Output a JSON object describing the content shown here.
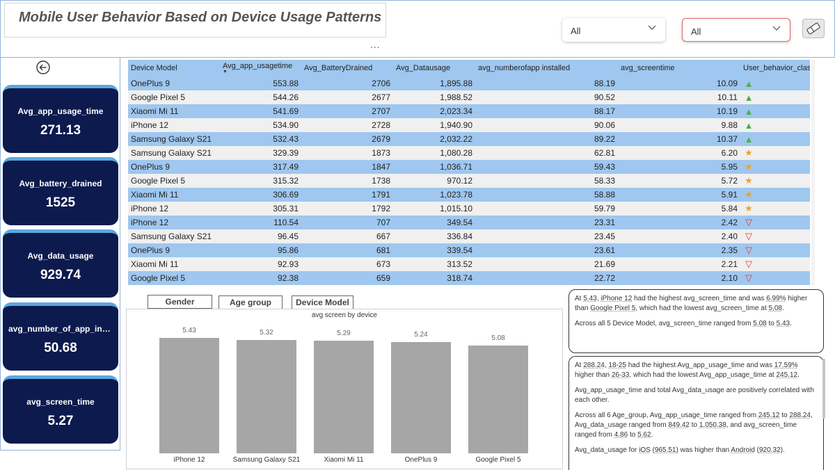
{
  "header": {
    "title": "Mobile User Behavior Based on Device Usage Patterns",
    "more_dots": "...",
    "slicer_1_value": "All",
    "slicer_2_value": "All"
  },
  "kpis": [
    {
      "label": "Avg_app_usage_time",
      "value": "271.13"
    },
    {
      "label": "Avg_battery_drained",
      "value": "1525"
    },
    {
      "label": "Avg_data_usage",
      "value": "929.74"
    },
    {
      "label": "avg_number_of_app_inst...",
      "value": "50.68"
    },
    {
      "label": "avg_screen_time",
      "value": "5.27"
    }
  ],
  "table": {
    "columns": [
      "Device Model",
      "Avg_app_usagetime",
      "Avg_BatteryDrained",
      "Avg_Datausage",
      "avg_numberofapp installed",
      "avg_screentime",
      "User_behavior_class"
    ],
    "rows": [
      {
        "device": "OnePlus 9",
        "app": "553.88",
        "battery": "2706",
        "data": "1,895.88",
        "apps": "88.19",
        "screen": "10.09",
        "ind": "up"
      },
      {
        "device": "Google Pixel 5",
        "app": "544.26",
        "battery": "2677",
        "data": "1,988.52",
        "apps": "90.52",
        "screen": "10.11",
        "ind": "up"
      },
      {
        "device": "Xiaomi Mi 11",
        "app": "541.69",
        "battery": "2707",
        "data": "2,023.34",
        "apps": "88.17",
        "screen": "10.19",
        "ind": "up"
      },
      {
        "device": "iPhone 12",
        "app": "534.90",
        "battery": "2728",
        "data": "1,940.90",
        "apps": "90.06",
        "screen": "9.88",
        "ind": "up"
      },
      {
        "device": "Samsung Galaxy S21",
        "app": "532.43",
        "battery": "2679",
        "data": "2,032.22",
        "apps": "89.22",
        "screen": "10.37",
        "ind": "up"
      },
      {
        "device": "Samsung Galaxy S21",
        "app": "329.39",
        "battery": "1873",
        "data": "1,080.28",
        "apps": "62.81",
        "screen": "6.20",
        "ind": "star"
      },
      {
        "device": "OnePlus 9",
        "app": "317.49",
        "battery": "1847",
        "data": "1,036.71",
        "apps": "59.43",
        "screen": "5.95",
        "ind": "star"
      },
      {
        "device": "Google Pixel 5",
        "app": "315.32",
        "battery": "1738",
        "data": "970.12",
        "apps": "58.33",
        "screen": "5.72",
        "ind": "star"
      },
      {
        "device": "Xiaomi Mi 11",
        "app": "306.69",
        "battery": "1791",
        "data": "1,023.78",
        "apps": "58.88",
        "screen": "5.91",
        "ind": "star"
      },
      {
        "device": "iPhone 12",
        "app": "305.31",
        "battery": "1792",
        "data": "1,015.10",
        "apps": "59.79",
        "screen": "5.84",
        "ind": "star"
      },
      {
        "device": "iPhone 12",
        "app": "110.54",
        "battery": "707",
        "data": "349.54",
        "apps": "23.31",
        "screen": "2.42",
        "ind": "down"
      },
      {
        "device": "Samsung Galaxy S21",
        "app": "96.45",
        "battery": "667",
        "data": "336.84",
        "apps": "23.45",
        "screen": "2.40",
        "ind": "down"
      },
      {
        "device": "OnePlus 9",
        "app": "95.86",
        "battery": "681",
        "data": "339.54",
        "apps": "23.61",
        "screen": "2.35",
        "ind": "down"
      },
      {
        "device": "Xiaomi Mi 11",
        "app": "92.93",
        "battery": "673",
        "data": "313.52",
        "apps": "21.69",
        "screen": "2.21",
        "ind": "down"
      },
      {
        "device": "Google Pixel 5",
        "app": "92.38",
        "battery": "659",
        "data": "318.74",
        "apps": "22.72",
        "screen": "2.10",
        "ind": "down"
      }
    ]
  },
  "tabs": [
    "Gender",
    "Age group",
    "Device Model"
  ],
  "chart_data": {
    "type": "bar",
    "title": "avg screen by device",
    "categories": [
      "iPhone 12",
      "Samsung Galaxy S21",
      "Xiaomi Mi 11",
      "OnePlus 9",
      "Google Pixel 5"
    ],
    "values": [
      5.43,
      5.32,
      5.29,
      5.24,
      5.08
    ],
    "data_labels": [
      "5.43",
      "5.32",
      "5.29",
      "5.24",
      "5.08"
    ],
    "ylim": [
      0,
      5.43
    ],
    "color": "#a6a6a6",
    "grid": false
  },
  "narrative_1": {
    "p1": [
      {
        "t": "At "
      },
      {
        "t": "5.43",
        "u": true
      },
      {
        "t": ", "
      },
      {
        "t": "iPhone 12",
        "u": true
      },
      {
        "t": " had the highest avg_screen_time and was "
      },
      {
        "t": "6.99%",
        "u": true
      },
      {
        "t": " higher than "
      },
      {
        "t": "Google Pixel 5",
        "u": true
      },
      {
        "t": ", which had the lowest avg_screen_time at "
      },
      {
        "t": "5.08",
        "u": true
      },
      {
        "t": "."
      }
    ],
    "p2": [
      {
        "t": "Across all 5 Device Model, avg_screen_time ranged from "
      },
      {
        "t": "5.08",
        "u": true
      },
      {
        "t": " to "
      },
      {
        "t": "5.43",
        "u": true
      },
      {
        "t": "."
      }
    ]
  },
  "narrative_2": {
    "p1": [
      {
        "t": "At "
      },
      {
        "t": "288.24",
        "u": true
      },
      {
        "t": ", "
      },
      {
        "t": "18-25",
        "u": true
      },
      {
        "t": " had the highest Avg_app_usage_time and was "
      },
      {
        "t": "17.59%",
        "u": true
      },
      {
        "t": " higher than "
      },
      {
        "t": "26-33",
        "u": true
      },
      {
        "t": ", which had the lowest Avg_app_usage_time at "
      },
      {
        "t": "245.12",
        "u": true
      },
      {
        "t": "."
      }
    ],
    "p2": [
      {
        "t": "Avg_app_usage_time and total Avg_data_usage are positively correlated with each other."
      }
    ],
    "p3": [
      {
        "t": "Across all 6 Age_group, Avg_app_usage_time ranged from "
      },
      {
        "t": "245.12",
        "u": true
      },
      {
        "t": " to "
      },
      {
        "t": "288.24",
        "u": true
      },
      {
        "t": ", Avg_data_usage ranged from "
      },
      {
        "t": "849.42",
        "u": true
      },
      {
        "t": " to "
      },
      {
        "t": "1,050.38",
        "u": true
      },
      {
        "t": ", and avg_screen_time ranged from "
      },
      {
        "t": "4.86",
        "u": true
      },
      {
        "t": " to "
      },
      {
        "t": "5.62",
        "u": true
      },
      {
        "t": "."
      }
    ],
    "p4": [
      {
        "t": "Avg_data_usage for "
      },
      {
        "t": "iOS",
        "u": true
      },
      {
        "t": " ("
      },
      {
        "t": "965.51",
        "u": true
      },
      {
        "t": ") was higher than "
      },
      {
        "t": "Android",
        "u": true
      },
      {
        "t": " ("
      },
      {
        "t": "920.32",
        "u": true
      },
      {
        "t": ")."
      }
    ]
  },
  "icons": {
    "back": "arrow-left-circle-icon",
    "dropdown": "chevron-down-icon",
    "eraser": "eraser-icon"
  },
  "colors": {
    "kpi_bg": "#0d1a4e",
    "kpi_accent": "#5aa8e0",
    "row_blue": "#9fc7ef",
    "row_grey": "#f0f0f0",
    "up": "#4caf50",
    "star": "#f0a030",
    "down": "#e53935",
    "bar": "#a6a6a6"
  }
}
